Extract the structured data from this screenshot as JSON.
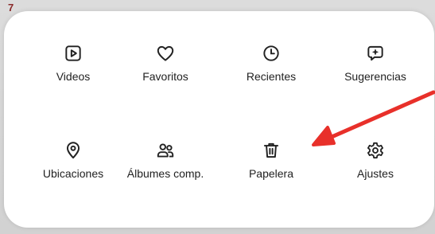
{
  "header": {
    "corner_text": "7"
  },
  "menu": {
    "items": [
      {
        "label": "Videos",
        "icon": "play-square-icon"
      },
      {
        "label": "Favoritos",
        "icon": "heart-icon"
      },
      {
        "label": "Recientes",
        "icon": "clock-icon"
      },
      {
        "label": "Sugerencias",
        "icon": "sparkle-chat-icon"
      },
      {
        "label": "Ubicaciones",
        "icon": "location-pin-icon"
      },
      {
        "label": "Álbumes comp.",
        "icon": "people-icon"
      },
      {
        "label": "Papelera",
        "icon": "trash-icon"
      },
      {
        "label": "Ajustes",
        "icon": "gear-icon"
      }
    ]
  },
  "colors": {
    "arrow": "#e8302a",
    "panel": "#ffffff",
    "text": "#222222"
  }
}
